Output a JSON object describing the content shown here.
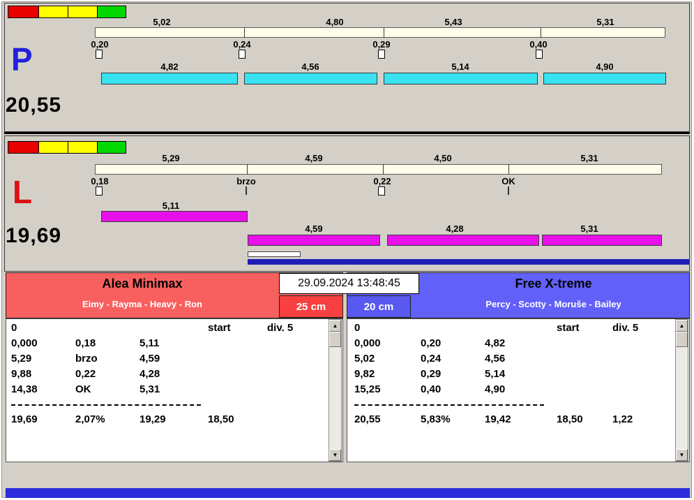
{
  "window": {
    "datetime": "29.09.2024 13:48:45"
  },
  "palette": {
    "window_bg": "#d4d0c8",
    "split_bar": "#fffde9",
    "cyan_bar": "#38e2f0",
    "magenta_bar": "#e810e8",
    "navy_bar": "#1f1fb8",
    "bottom_strip": "#2b2bdc",
    "left_header": "#f8605f",
    "left_chip": "#f84040",
    "right_header": "#6160f8",
    "right_chip": "#5958f0",
    "traffic_red": "#e80000",
    "traffic_yellow": "#ffff00",
    "traffic_green": "#00d800",
    "letter_p_color": "#2020dd",
    "letter_l_color": "#dd1010"
  },
  "icons": {
    "scroll_up": "▲",
    "scroll_down": "▼"
  },
  "lane_p": {
    "letter": "P",
    "total": "20,55",
    "segments": [
      "5,02",
      "4,80",
      "5,43",
      "5,31"
    ],
    "markers": [
      "0,20",
      "0,24",
      "0,29",
      "0,40"
    ],
    "bar_labels": [
      "4,82",
      "4,56",
      "5,14",
      "4,90"
    ]
  },
  "lane_l": {
    "letter": "L",
    "total": "19,69",
    "segments": [
      "5,29",
      "4,59",
      "4,50",
      "5,31"
    ],
    "markers": [
      "0,18",
      "brzo",
      "0,22",
      "OK"
    ],
    "bar_labels": [
      "5,11",
      "4,59",
      "4,28",
      "5,31"
    ]
  },
  "team_left": {
    "name": "Alea Minimax",
    "dogs": "Eimy - Rayma - Heavy - Ron",
    "height": "25 cm",
    "table": {
      "zero": "0",
      "start": "start",
      "division": "div. 5",
      "rows": [
        [
          "0,000",
          "0,18",
          "5,11"
        ],
        [
          "5,29",
          "brzo",
          "4,59"
        ],
        [
          "9,88",
          "0,22",
          "4,28"
        ],
        [
          "14,38",
          "OK",
          "5,31"
        ]
      ],
      "summary": [
        "19,69",
        "2,07%",
        "19,29",
        "18,50"
      ]
    }
  },
  "team_right": {
    "name": "Free X-treme",
    "dogs": "Percy - Scotty - Moruše - Bailey",
    "height": "20 cm",
    "table": {
      "zero": "0",
      "start": "start",
      "division": "div. 5",
      "rows": [
        [
          "0,000",
          "0,20",
          "4,82"
        ],
        [
          "5,02",
          "0,24",
          "4,56"
        ],
        [
          "9,82",
          "0,29",
          "5,14"
        ],
        [
          "15,25",
          "0,40",
          "4,90"
        ]
      ],
      "summary": [
        "20,55",
        "5,83%",
        "19,42",
        "18,50",
        "1,22"
      ]
    }
  }
}
